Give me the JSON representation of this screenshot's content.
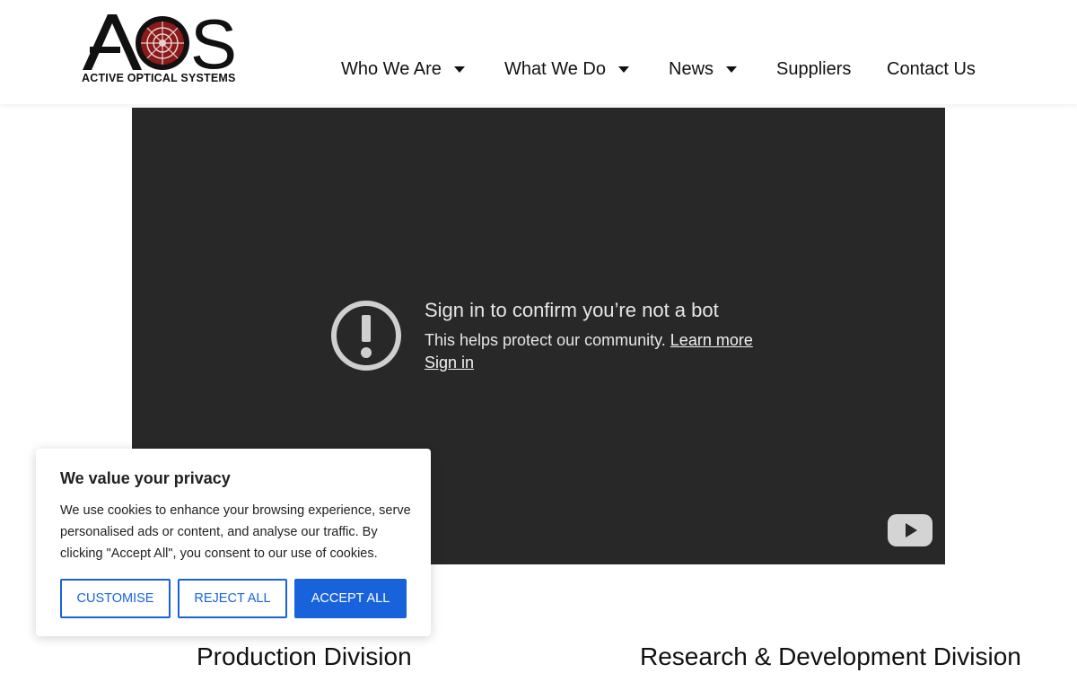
{
  "logo": {
    "mark_text": "AOS",
    "caption": "ACTIVE OPTICAL SYSTEMS"
  },
  "nav": {
    "items": [
      {
        "label": "Who We Are",
        "has_dropdown": true
      },
      {
        "label": "What We Do",
        "has_dropdown": true
      },
      {
        "label": "News",
        "has_dropdown": true
      },
      {
        "label": "Suppliers",
        "has_dropdown": false
      },
      {
        "label": "Contact Us",
        "has_dropdown": false
      }
    ]
  },
  "video": {
    "title": "Sign in to confirm you’re not a bot",
    "body": "This helps protect our community.",
    "learn_more": "Learn more",
    "sign_in": "Sign in",
    "icons": [
      "alert-icon",
      "youtube-icon"
    ]
  },
  "sections": {
    "left_heading": "Production Division",
    "right_heading": "Research & Development Division"
  },
  "cookie": {
    "title": "We value your privacy",
    "text": "We use cookies to enhance your browsing experience, serve personalised ads or content, and analyse our traffic. By clicking \"Accept All\", you consent to our use of cookies.",
    "customise": "CUSTOMISE",
    "reject": "REJECT ALL",
    "accept": "ACCEPT ALL"
  },
  "colors": {
    "accent": "#1863dc",
    "video_bg": "#282828",
    "logo_red": "#8b1a1a"
  }
}
